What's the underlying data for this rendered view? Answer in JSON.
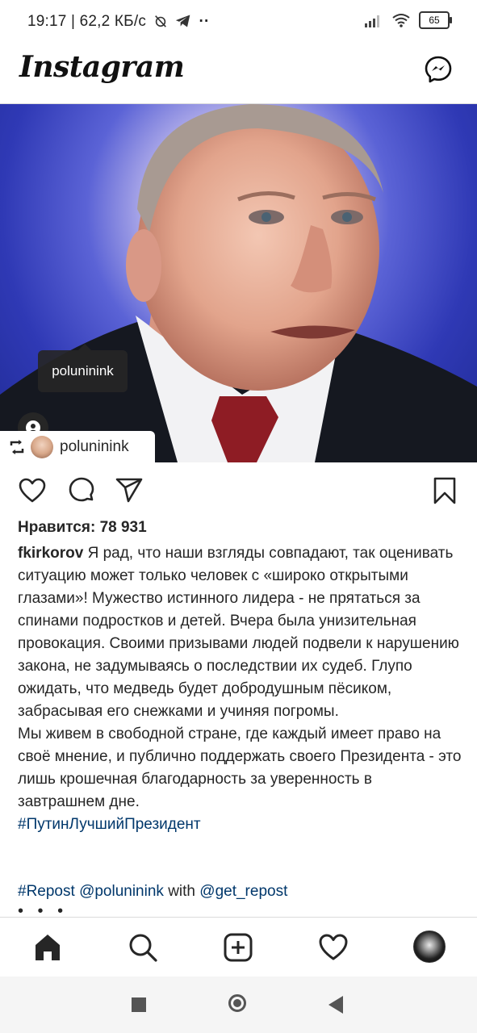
{
  "status_bar": {
    "left_text": "19:17 | 62,2 КБ/с",
    "battery": "65",
    "icons": [
      "alarm-off-icon",
      "telegram-icon",
      "more-dots-icon",
      "signal-icon",
      "wifi-icon",
      "battery-icon"
    ]
  },
  "header": {
    "logo": "Instagram",
    "icons": [
      "messenger-icon"
    ]
  },
  "post": {
    "tag_bubble": "poluninink",
    "repost_badge_user": "poluninink",
    "likes": "Нравится: 78 931",
    "author": "fkirkorov",
    "caption_first": " Я рад, что наши взгляды совпадают, так оценивать ситуацию может только человек с «широко открытыми глазами»! Мужество истинного лидера - не прятаться за спинами подростков и детей. Вчера была унизительная провокация. Своими призывами людей подвели к нарушению закона, не задумываясь о последствии их судеб. Глупо ожидать, что медведь будет добродушным пёсиком, забрасывая его снежками и учиняя погромы.",
    "caption_second": "Мы живем в свободной стране, где каждый имеет право на своё мнение, и публично поддержать своего Президента - это лишь крошечная благодарность за уверенность в завтрашнем дне.",
    "hashtag": "#ПутинЛучшийПрезидент",
    "repost_hashtag": "#Repost",
    "repost_user": "@poluninink",
    "repost_with": " with ",
    "repost_app": "@get_repost",
    "more": "• • •",
    "action_icons": [
      "heart-icon",
      "comment-icon",
      "share-icon",
      "bookmark-icon"
    ]
  },
  "bottom_nav": {
    "items": [
      "home-icon",
      "search-icon",
      "new-post-icon",
      "activity-heart-icon",
      "profile-avatar"
    ]
  },
  "system_nav": [
    "recents-button",
    "home-button",
    "back-button"
  ],
  "colors": {
    "text": "#262626",
    "link": "#00376b",
    "divider": "#dbdbdb"
  }
}
